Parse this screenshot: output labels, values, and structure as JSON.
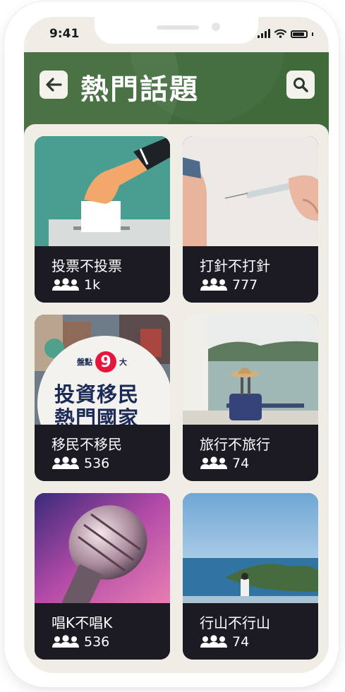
{
  "status_bar": {
    "time": "9:41"
  },
  "header": {
    "title": "熱門話題",
    "back_icon": "arrow-left-icon",
    "search_icon": "search-icon",
    "background_color": "#3f6a3a"
  },
  "topics": [
    {
      "title": "投票不投票",
      "count": "1k",
      "image": "voting-ballot-box"
    },
    {
      "title": "打針不打針",
      "count": "777",
      "image": "vaccine-syringe"
    },
    {
      "title": "移民不移民",
      "count": "536",
      "image": "immigration-poster",
      "poster_text": {
        "prefix": "盤點",
        "number": "9",
        "suffix": "大",
        "line1": "投資移民",
        "line2": "熱門國家"
      }
    },
    {
      "title": "旅行不旅行",
      "count": "74",
      "image": "suitcase-by-window"
    },
    {
      "title": "唱K不唱K",
      "count": "536",
      "image": "karaoke-microphone"
    },
    {
      "title": "行山不行山",
      "count": "74",
      "image": "hiker-on-hill"
    }
  ],
  "colors": {
    "card_bg": "#1c1a22",
    "content_bg": "#efede6",
    "accent_red": "#e3173e",
    "poster_navy": "#1b2a57"
  }
}
